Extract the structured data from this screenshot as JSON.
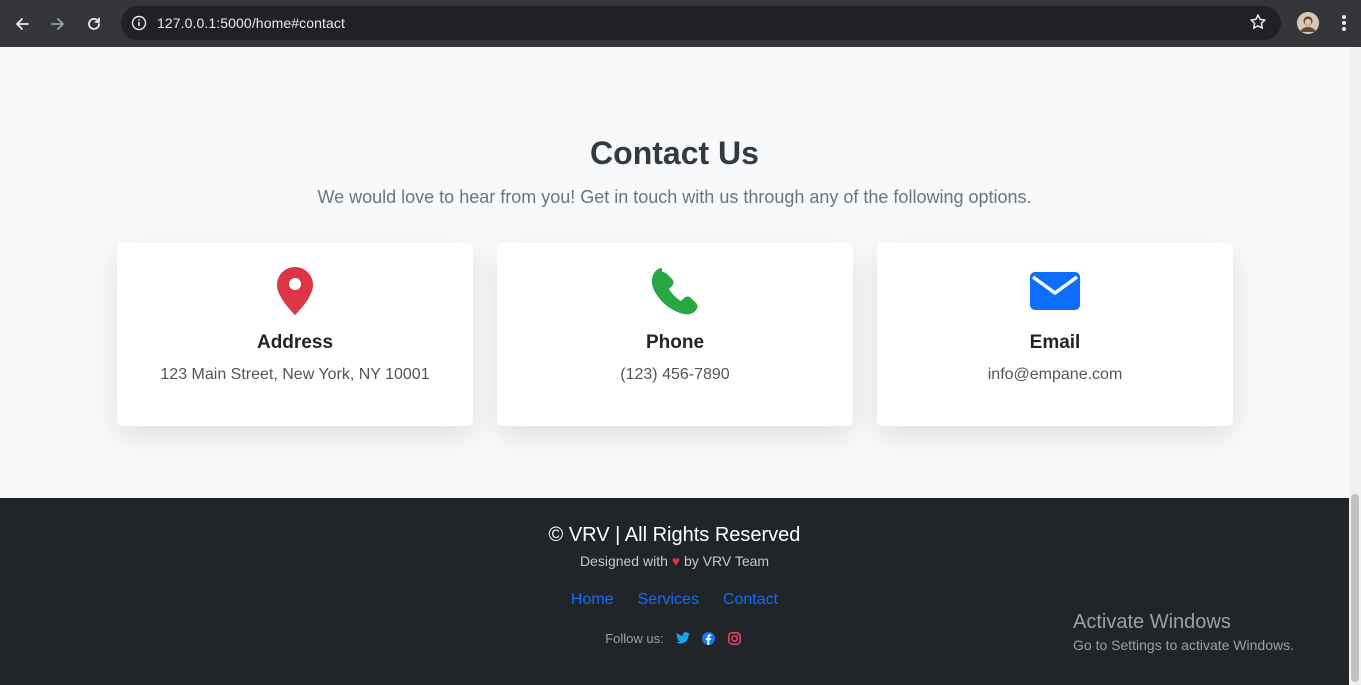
{
  "browser": {
    "url": "127.0.0.1:5000/home#contact"
  },
  "contact": {
    "title": "Contact Us",
    "subtitle": "We would love to hear from you! Get in touch with us through any of the following options.",
    "cards": [
      {
        "icon": "map-pin-icon",
        "title": "Address",
        "text": "123 Main Street, New York, NY 10001",
        "color": "#dc3545"
      },
      {
        "icon": "phone-icon",
        "title": "Phone",
        "text": "(123) 456-7890",
        "color": "#28a745"
      },
      {
        "icon": "envelope-icon",
        "title": "Email",
        "text": "info@empane.com",
        "color": "#0d6efd"
      }
    ]
  },
  "footer": {
    "copyright": "© VRV | All Rights Reserved",
    "designed_prefix": "Designed with",
    "heart": "♥",
    "designed_suffix": "by VRV Team",
    "links": [
      "Home",
      "Services",
      "Contact"
    ],
    "follow_label": "Follow us:",
    "social": [
      "twitter-icon",
      "facebook-icon",
      "instagram-icon"
    ]
  },
  "watermark": {
    "title": "Activate Windows",
    "subtitle": "Go to Settings to activate Windows."
  }
}
